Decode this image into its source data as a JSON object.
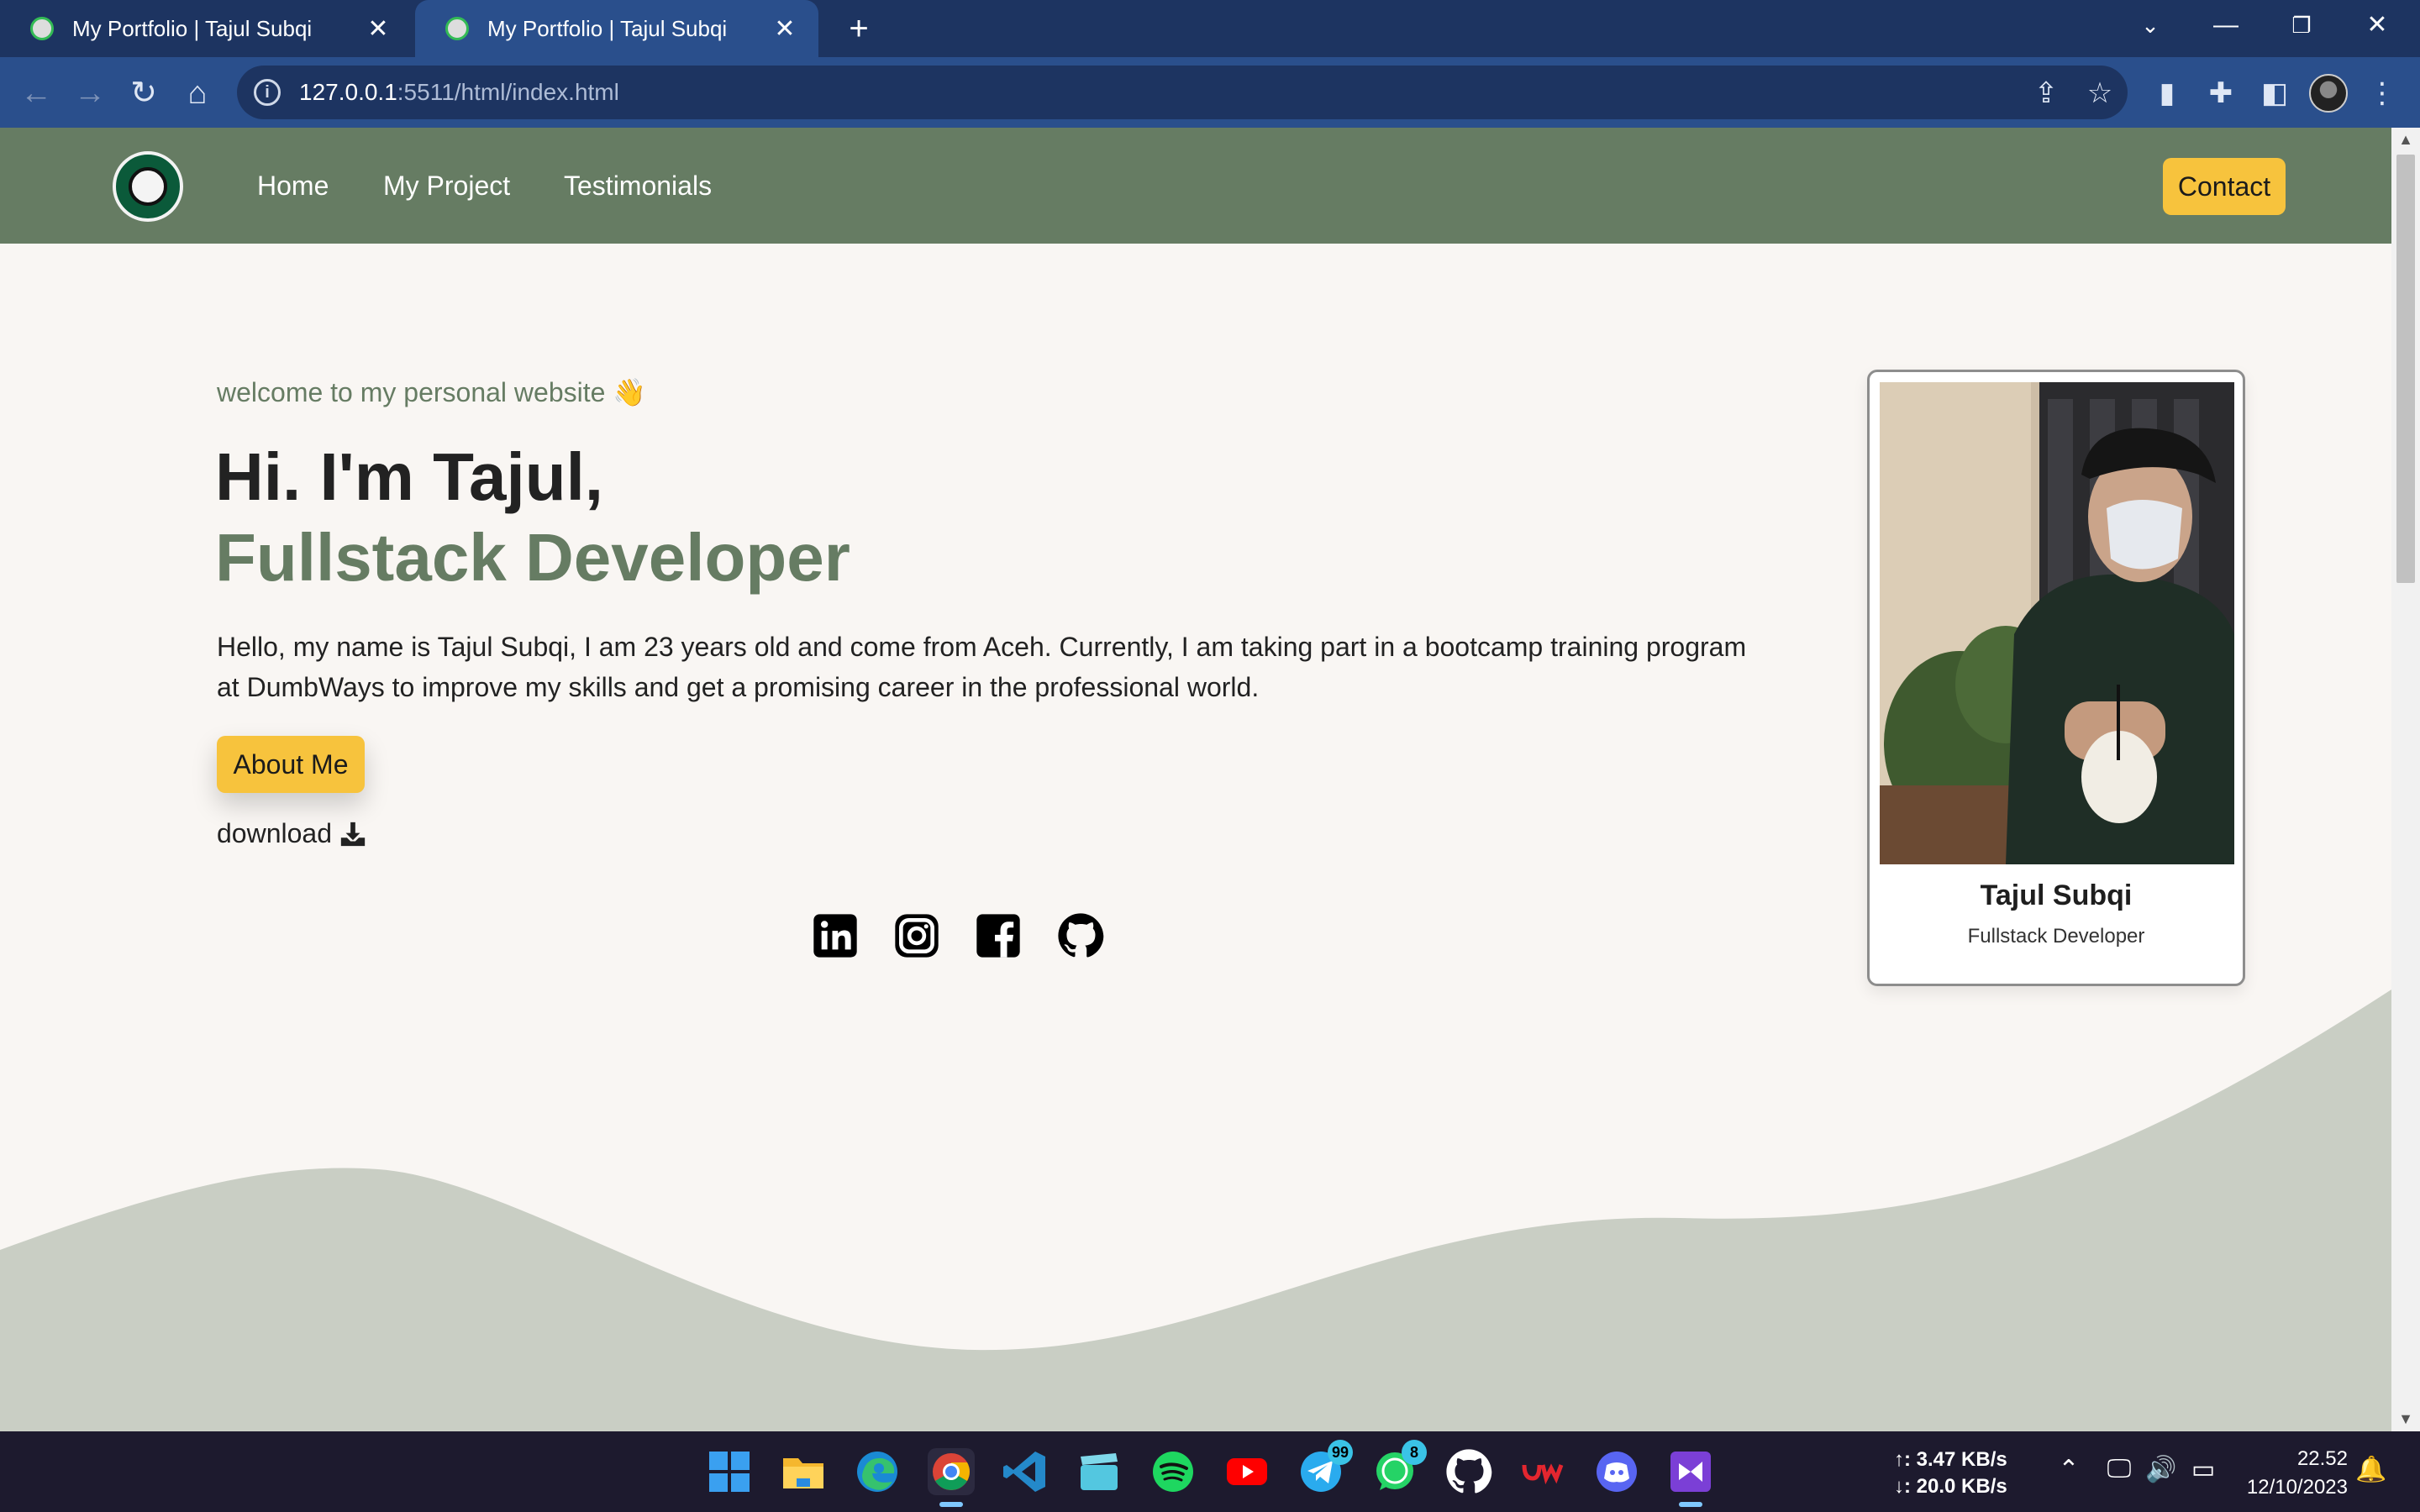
{
  "browser": {
    "tabs": [
      {
        "title": "My Portfolio | Tajul Subqi",
        "active": false
      },
      {
        "title": "My Portfolio | Tajul Subqi",
        "active": true
      }
    ],
    "url_host": "127.0.0.1",
    "url_rest": ":5511/html/index.html"
  },
  "site": {
    "nav": {
      "home": "Home",
      "project": "My Project",
      "testimonials": "Testimonials",
      "contact": "Contact"
    },
    "hero": {
      "welcome": "welcome to my personal website 👋",
      "greeting": "Hi. I'm Tajul,",
      "role": "Fullstack Developer",
      "intro": "Hello, my name is Tajul Subqi, I am 23 years old and come from Aceh. Currently, I am taking part in a bootcamp training program at DumbWays to improve my skills and get a promising career in the professional world.",
      "about_button": "About Me",
      "download": "download"
    },
    "social": [
      "linkedin-icon",
      "instagram-icon",
      "facebook-icon",
      "github-icon"
    ],
    "card": {
      "name": "Tajul Subqi",
      "role": "Fullstack Developer"
    },
    "colors": {
      "primary": "#667c63",
      "accent": "#f7c33d",
      "background": "#f9f6f3",
      "wave": "#c9cec4"
    }
  },
  "taskbar": {
    "apps": [
      "windows-start-icon",
      "file-explorer-icon",
      "edge-icon",
      "chrome-icon",
      "vscode-icon",
      "clapper-icon",
      "spotify-icon",
      "youtube-icon",
      "telegram-icon",
      "whatsapp-icon",
      "github-icon",
      "dumbways-icon",
      "discord-icon",
      "visual-studio-icon"
    ],
    "telegram_badge": "99",
    "whatsapp_badge": "8",
    "net_up": "↑: 3.47 KB/s",
    "net_down": "↓: 20.0 KB/s",
    "time": "22.52",
    "date": "12/10/2023"
  }
}
